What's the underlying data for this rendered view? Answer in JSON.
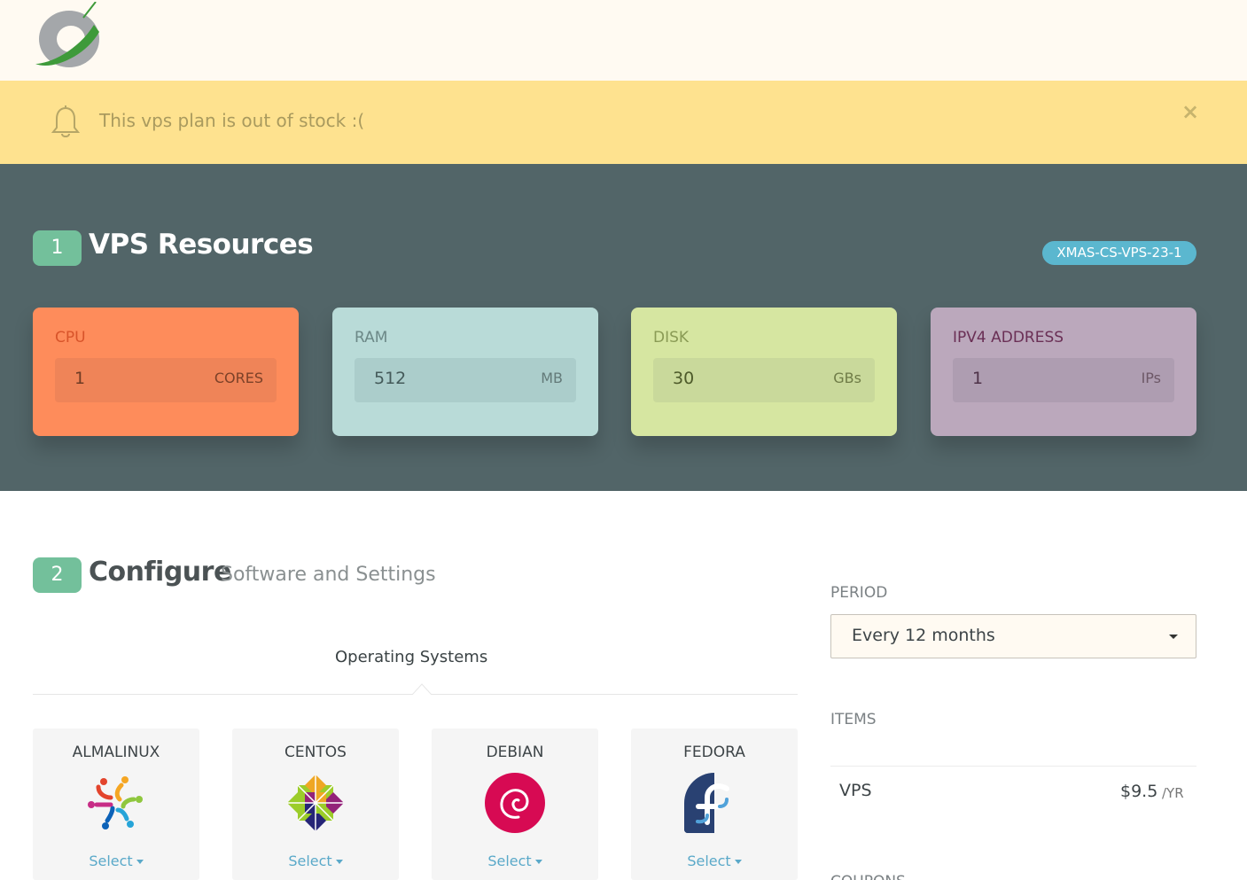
{
  "alert": {
    "message": "This vps plan is out of stock :(",
    "close_symbol": "×",
    "icon": "bell-icon"
  },
  "resources": {
    "step": "1",
    "title": "VPS Resources",
    "plan_code": "XMAS-CS-VPS-23-1",
    "cards": [
      {
        "label": "CPU",
        "value": "1",
        "unit": "CORES",
        "color": "#fe8c5b"
      },
      {
        "label": "RAM",
        "value": "512",
        "unit": "MB",
        "color": "#b9dbd8"
      },
      {
        "label": "DISK",
        "value": "30",
        "unit": "GBs",
        "color": "#d6e6a1"
      },
      {
        "label": "IPV4 ADDRESS",
        "value": "1",
        "unit": "IPs",
        "color": "#bba8bc"
      }
    ]
  },
  "configure": {
    "step": "2",
    "title": "Configure",
    "subtitle": "Software and Settings",
    "tab": "Operating Systems",
    "os": [
      {
        "name": "ALMALINUX",
        "select": "Select",
        "icon": "almalinux-icon"
      },
      {
        "name": "CENTOS",
        "select": "Select",
        "icon": "centos-icon"
      },
      {
        "name": "DEBIAN",
        "select": "Select",
        "icon": "debian-icon"
      },
      {
        "name": "FEDORA",
        "select": "Select",
        "icon": "fedora-icon"
      }
    ]
  },
  "sidebar": {
    "period_label": "PERIOD",
    "period_value": "Every 12 months",
    "items_label": "ITEMS",
    "item": {
      "name": "VPS",
      "price": "$9.5",
      "period": "/YR"
    },
    "coupons_label": "COUPONS"
  },
  "colors": {
    "accent_green": "#73c09b",
    "alert_bg": "#fee28f",
    "dark_section": "#526568",
    "tag_blue": "#5bb7cf",
    "link_blue": "#5aa9c9"
  }
}
